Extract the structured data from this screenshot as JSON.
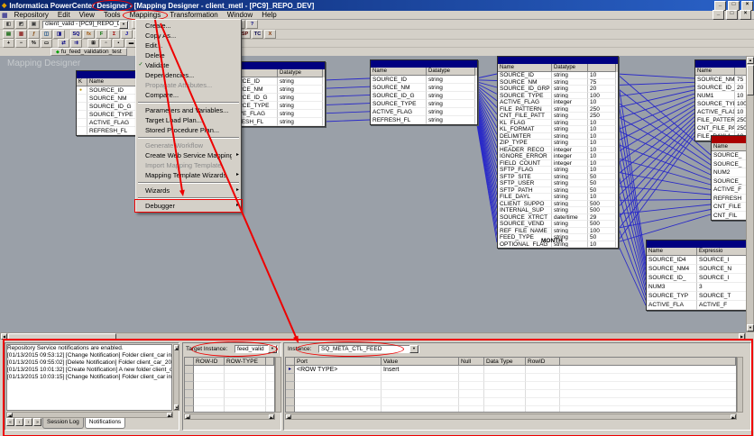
{
  "window": {
    "title_pre": "Informatica PowerCenter ",
    "title_emph": "Designer",
    "title_post": " - [Mapping Designer - client_metl - [PC9]_REPO_DEV]",
    "controls": {
      "minimize": "_",
      "maximize": "□",
      "close": "×"
    }
  },
  "icons": {
    "app": "◆",
    "child_window": "▦",
    "dropdown": "▼",
    "submenu": "▸",
    "up": "▲",
    "down": "▼",
    "left": "◀",
    "right": "▶",
    "row_marker": "▸"
  },
  "menubar": {
    "items": [
      "Repository",
      "Edit",
      "View",
      "Tools",
      "Mappings",
      "Transformation",
      "Window",
      "Help"
    ]
  },
  "annotations": {
    "circled_menu": "Mappings",
    "highlighted_menu_item": "Debugger"
  },
  "toolbar1": {
    "combo_value": "client_valid - [PC9]_REPO_DEV",
    "icons_left": [
      {
        "name": "toggle-repository-navigator-icon",
        "glyph": "◧",
        "color": "#404040"
      },
      {
        "name": "toggle-output-window-icon",
        "glyph": "◩",
        "color": "#404040"
      },
      {
        "name": "toggle-overview-window-icon",
        "glyph": "▣",
        "color": "#404040"
      }
    ],
    "icons_right": [
      {
        "name": "save-icon",
        "glyph": "▦",
        "color": "#000080"
      },
      {
        "name": "print-icon",
        "glyph": "▤",
        "color": "#404040"
      },
      {
        "sep": true
      },
      {
        "name": "cut-icon",
        "glyph": "✂",
        "color": "#404040"
      },
      {
        "name": "copy-icon",
        "glyph": "▣",
        "color": "#404040"
      },
      {
        "name": "paste-icon",
        "glyph": "▩",
        "color": "#806000"
      },
      {
        "sep": true
      },
      {
        "name": "undo-icon",
        "glyph": "↶",
        "color": "#000080"
      },
      {
        "name": "redo-icon",
        "glyph": "↷",
        "color": "#000080"
      },
      {
        "sep": true
      },
      {
        "name": "find-icon",
        "glyph": "◎",
        "color": "#404040"
      },
      {
        "name": "help-icon",
        "glyph": "?",
        "color": "#000080"
      }
    ]
  },
  "toolbar2": {
    "icons": [
      {
        "name": "source-analyzer-icon",
        "glyph": "▤",
        "color": "#006000"
      },
      {
        "name": "target-designer-icon",
        "glyph": "▥",
        "color": "#800000"
      },
      {
        "name": "transformation-developer-icon",
        "glyph": "ƒ",
        "color": "#804000"
      },
      {
        "name": "mapplet-designer-icon",
        "glyph": "◫",
        "color": "#004080"
      },
      {
        "name": "mapping-designer-icon",
        "glyph": "◨",
        "color": "#000080"
      },
      {
        "sep": true
      },
      {
        "name": "source-qualifier-icon",
        "glyph": "SQ",
        "color": "#000080"
      },
      {
        "name": "expression-icon",
        "glyph": "fx",
        "color": "#a05000"
      },
      {
        "name": "filter-icon",
        "glyph": "F",
        "color": "#007000"
      },
      {
        "name": "aggregator-icon",
        "glyph": "Σ",
        "color": "#a00000"
      },
      {
        "name": "joiner-icon",
        "glyph": "J",
        "color": "#0000a0"
      },
      {
        "name": "lookup-icon",
        "glyph": "L",
        "color": "#a000a0"
      },
      {
        "name": "rank-icon",
        "glyph": "R",
        "color": "#006060"
      },
      {
        "name": "router-icon",
        "glyph": "Rt",
        "color": "#604000"
      },
      {
        "name": "sequence-generator-icon",
        "glyph": "S#",
        "color": "#005050"
      },
      {
        "name": "sorter-icon",
        "glyph": "↕",
        "color": "#303030"
      },
      {
        "name": "union-icon",
        "glyph": "U",
        "color": "#500050"
      },
      {
        "name": "update-strategy-icon",
        "glyph": "US",
        "color": "#703000"
      },
      {
        "sep": true
      },
      {
        "name": "normalizer-icon",
        "glyph": "N",
        "color": "#005000"
      },
      {
        "name": "stored-procedure-icon",
        "glyph": "SP",
        "color": "#500000"
      },
      {
        "name": "transaction-control-icon",
        "glyph": "TC",
        "color": "#000050"
      },
      {
        "name": "xml-parser-icon",
        "glyph": "X",
        "color": "#803000"
      }
    ]
  },
  "toolbar3": {
    "icons": [
      {
        "name": "zoom-in-icon",
        "glyph": "+",
        "color": "#000000"
      },
      {
        "name": "zoom-out-icon",
        "glyph": "−",
        "color": "#000000"
      },
      {
        "name": "zoom-percent-icon",
        "glyph": "%",
        "color": "#000000"
      },
      {
        "name": "fit-to-window-icon",
        "glyph": "▭",
        "color": "#000000"
      },
      {
        "sep": true
      },
      {
        "name": "link-ports-icon",
        "glyph": "⇄",
        "color": "#000080"
      },
      {
        "name": "propagate-ports-icon",
        "glyph": "⇉",
        "color": "#000080"
      },
      {
        "sep": true
      },
      {
        "name": "arrange-all-icon",
        "glyph": "⊞",
        "color": "#000000"
      },
      {
        "name": "arrange-iconic-icon",
        "glyph": "▫",
        "color": "#000000"
      },
      {
        "name": "expand-windows-icon",
        "glyph": "▪",
        "color": "#000000"
      },
      {
        "name": "toggle-dock-icon",
        "glyph": "▬",
        "color": "#000000"
      }
    ]
  },
  "workspace_tab": {
    "icon": "◆",
    "label": "fu_feed_validation_test"
  },
  "mappings_menu": {
    "items": [
      {
        "label": "Create...",
        "enabled": true
      },
      {
        "label": "Copy As...",
        "enabled": true
      },
      {
        "label": "Edit...",
        "enabled": true
      },
      {
        "label": "Delete",
        "enabled": true
      },
      {
        "label": "Validate",
        "enabled": true,
        "icon_glyph": "✓"
      },
      {
        "label": "Dependencies...",
        "enabled": true
      },
      {
        "label": "Propagate Attributes...",
        "enabled": false
      },
      {
        "label": "Compare...",
        "enabled": true
      },
      {
        "sep": true
      },
      {
        "label": "Parameters and Variables...",
        "enabled": true
      },
      {
        "label": "Target Load Plan...",
        "enabled": true
      },
      {
        "label": "Stored Procedure Plan...",
        "enabled": true
      },
      {
        "sep": true
      },
      {
        "label": "Generate Workflow",
        "enabled": false
      },
      {
        "label": "Create Web Service Mapping",
        "enabled": true,
        "submenu": true
      },
      {
        "label": "Import Mapping Template",
        "enabled": false
      },
      {
        "label": "Mapping Template Wizards",
        "enabled": true,
        "submenu": true
      },
      {
        "sep": true
      },
      {
        "label": "Wizards",
        "enabled": true,
        "submenu": true
      },
      {
        "sep": true
      },
      {
        "label": "Debugger",
        "enabled": true,
        "submenu": true,
        "highlight": true
      }
    ]
  },
  "canvas": {
    "watermark": "Mapping Designer",
    "floating_label": "MONTH",
    "tables": [
      {
        "id": "t1",
        "title": "",
        "title_color": "#000080",
        "columns": [
          "K",
          "Name"
        ],
        "rows": [
          [
            "●",
            "SOURCE_ID"
          ],
          [
            "",
            "SOURCE_NM"
          ],
          [
            "",
            "SOURCE_ID_G"
          ],
          [
            "",
            "SOURCE_TYPE"
          ],
          [
            "",
            "ACTIVE_FLAG"
          ],
          [
            "",
            "REFRESH_FL"
          ]
        ]
      },
      {
        "id": "t2",
        "title": "",
        "title_color": "#000080",
        "columns": [
          "Name",
          "Datatype"
        ],
        "rows": [
          [
            "SOURCE_ID",
            "string"
          ],
          [
            "SOURCE_NM",
            "string"
          ],
          [
            "SOURCE_ID_G",
            "string"
          ],
          [
            "SOURCE_TYPE",
            "string"
          ],
          [
            "ACTIVE_FLAG",
            "string"
          ],
          [
            "REFRESH_FL",
            "string"
          ]
        ]
      },
      {
        "id": "t3",
        "title": "",
        "title_color": "#000080",
        "columns": [
          "Name",
          "Datatype"
        ],
        "rows": [
          [
            "SOURCE_ID",
            "string"
          ],
          [
            "SOURCE_NM",
            "string"
          ],
          [
            "SOURCE_ID_G",
            "string"
          ],
          [
            "SOURCE_TYPE",
            "string"
          ],
          [
            "ACTIVE_FLAG",
            "string"
          ],
          [
            "REFRESH_FL",
            "string"
          ]
        ]
      },
      {
        "id": "t4",
        "title": "",
        "title_color": "#000080",
        "columns": [
          "Name",
          "Datatype",
          ""
        ],
        "rows": [
          [
            "SOURCE_ID",
            "string",
            "10"
          ],
          [
            "SOURCE_NM",
            "string",
            "75"
          ],
          [
            "SOURCE_ID_GRP",
            "string",
            "20"
          ],
          [
            "SOURCE_TYPE",
            "string",
            "100"
          ],
          [
            "ACTIVE_FLAG",
            "integer",
            "10"
          ],
          [
            "FILE_PATTERN",
            "string",
            "250"
          ],
          [
            "CNT_FILE_PATT",
            "string",
            "250"
          ],
          [
            "KL_FLAG",
            "string",
            "10"
          ],
          [
            "KL_FORMAT",
            "string",
            "10"
          ],
          [
            "DELIMITER",
            "string",
            "10"
          ],
          [
            "ZIP_TYPE",
            "string",
            "10"
          ],
          [
            "HEADER_RECO",
            "integer",
            "10"
          ],
          [
            "IGNORE_ERROR",
            "integer",
            "10"
          ],
          [
            "FIELD_COUNT",
            "integer",
            "10"
          ],
          [
            "SFTP_FLAG",
            "string",
            "10"
          ],
          [
            "SFTP_SITE",
            "string",
            "50"
          ],
          [
            "SFTP_USER",
            "string",
            "50"
          ],
          [
            "SFTP_PATH",
            "string",
            "50"
          ],
          [
            "FILE_DAYL",
            "string",
            "10"
          ],
          [
            "CLIENT_SUPPO",
            "string",
            "500"
          ],
          [
            "INTERNAL_SUP",
            "string",
            "500"
          ],
          [
            "SOURCE_XTRCT",
            "date/time",
            "29"
          ],
          [
            "SOURCE_VEND",
            "string",
            "500"
          ],
          [
            "REF_FILE_NAME",
            "string",
            "100"
          ],
          [
            "FEED_TYPE",
            "string",
            "50"
          ],
          [
            "OPTIONAL_FLAG",
            "string",
            "10"
          ]
        ]
      },
      {
        "id": "t5",
        "title": "",
        "title_color": "#000080",
        "columns": [
          "Name",
          ""
        ],
        "rows": [
          [
            "SOURCE_NM1",
            "75"
          ],
          [
            "SOURCE_ID_",
            "20"
          ],
          [
            "NUM1",
            "10"
          ],
          [
            "SOURCE_TYP",
            "100"
          ],
          [
            "ACTIVE_FLA1",
            "10"
          ],
          [
            "FILE_PATTER",
            "250"
          ],
          [
            "CNT_FILE_PA",
            "250"
          ],
          [
            "FILE_DAYL1",
            "10"
          ]
        ]
      },
      {
        "id": "t6",
        "title": "",
        "title_color": "#aa0000",
        "columns": [
          "Name"
        ],
        "rows": [
          [
            "SOURCE_"
          ],
          [
            "SOURCE_"
          ],
          [
            "NUM2"
          ],
          [
            "SOURCE_"
          ],
          [
            "ACTIVE_F"
          ],
          [
            "REFRESH"
          ],
          [
            "CNT_FILE"
          ],
          [
            "CNT_FIL"
          ]
        ]
      },
      {
        "id": "t7",
        "title": "",
        "title_color": "#000080",
        "columns": [
          "Name",
          "Expressio"
        ],
        "rows": [
          [
            "SOURCE_ID4",
            "SOURCE_I"
          ],
          [
            "SOURCE_NM4",
            "SOURCE_N"
          ],
          [
            "SOURCE_ID_",
            "SOURCE_I"
          ],
          [
            "NUM3",
            "3"
          ],
          [
            "SOURCE_TYP",
            "SOURCE_T"
          ],
          [
            "ACTIVE_FLA",
            "ACTIVE_F"
          ]
        ]
      }
    ]
  },
  "bottom": {
    "output": {
      "lines": [
        "Repository Service notifications are enabled.",
        "[01/13/2015 09:53:12] [Change Notification] Folder client_car in repository [PC9]_REPO_DEV",
        "[01/13/2015 09:55:02] [Delete Notification] Folder client_car_20120321 in repository",
        "[01/13/2015 10:01:32] [Create Notification] A new folder client_car was created",
        "[01/13/2015 10:03:15] [Change Notification] Folder client_car in repository [PC9]_REPO_DEV"
      ],
      "tabs": [
        "Session Log",
        "Notifications"
      ],
      "active_tab": "Notifications",
      "tab_nav": [
        {
          "name": "tabs-scroll-first-icon",
          "glyph": "«"
        },
        {
          "name": "tabs-scroll-prev-icon",
          "glyph": "‹"
        },
        {
          "name": "tabs-scroll-next-icon",
          "glyph": "›"
        },
        {
          "name": "tabs-scroll-last-icon",
          "glyph": "»"
        }
      ]
    },
    "target": {
      "label": "Target Instance:",
      "value": "feed_valid",
      "grid_headers": [
        "ROW-ID",
        "ROW-TYPE"
      ]
    },
    "instance": {
      "label": "Instance:",
      "value": "SQ_META_CTL_FEED",
      "grid_headers": [
        "Port",
        "Value",
        "Null",
        "Data Type",
        "RowID"
      ],
      "rows": [
        [
          "<ROW TYPE>",
          "Insert",
          "",
          "",
          ""
        ]
      ]
    }
  },
  "colors": {
    "annotation": "#ee0000",
    "connector": "#2a2ac8",
    "canvas_bg": "#9aa0a8",
    "table_title_default": "#000080",
    "table_title_red": "#aa0000"
  }
}
